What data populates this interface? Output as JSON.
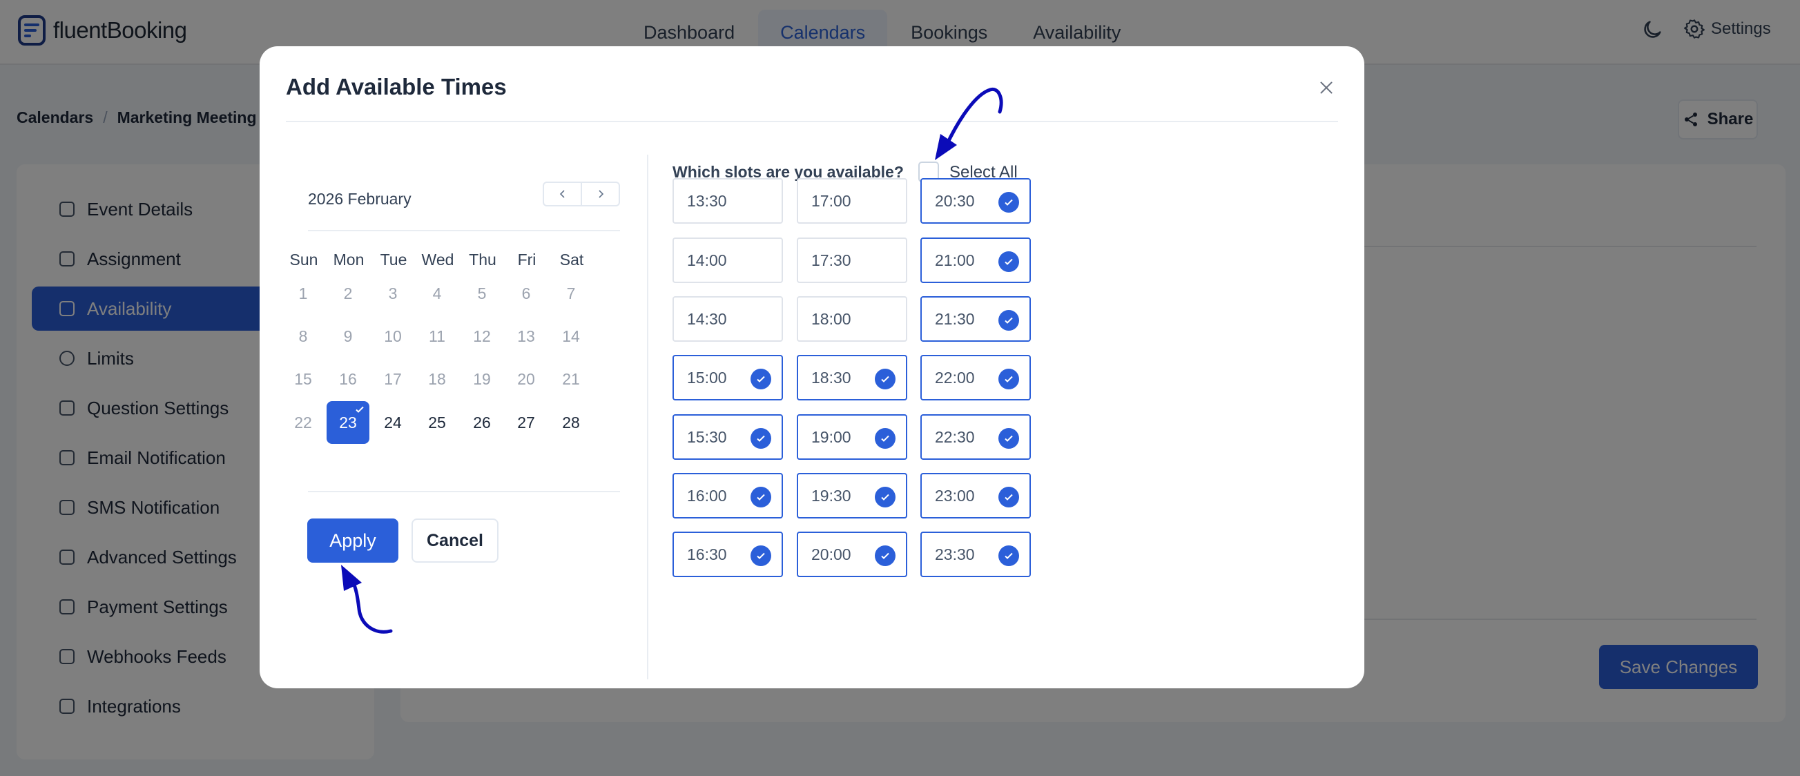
{
  "app": {
    "logo_text": "fluentBooking",
    "nav": [
      {
        "label": "Dashboard",
        "active": false
      },
      {
        "label": "Calendars",
        "active": true
      },
      {
        "label": "Bookings",
        "active": false
      },
      {
        "label": "Availability",
        "active": false
      }
    ],
    "settings_label": "Settings",
    "theme_icon": "moon-icon"
  },
  "breadcrumb": {
    "root": "Calendars",
    "current": "Marketing Meeting"
  },
  "share_label": "Share",
  "sidebar": {
    "items": [
      {
        "label": "Event Details",
        "icon": "document-icon"
      },
      {
        "label": "Assignment",
        "icon": "users-icon"
      },
      {
        "label": "Availability",
        "icon": "calendar-icon",
        "active": true
      },
      {
        "label": "Limits",
        "icon": "clock-icon"
      },
      {
        "label": "Question Settings",
        "icon": "question-icon"
      },
      {
        "label": "Email Notification",
        "icon": "mail-icon"
      },
      {
        "label": "SMS Notification",
        "icon": "sms-icon"
      },
      {
        "label": "Advanced Settings",
        "icon": "sliders-icon"
      },
      {
        "label": "Payment Settings",
        "icon": "payment-icon"
      },
      {
        "label": "Webhooks Feeds",
        "icon": "link-icon"
      },
      {
        "label": "Integrations",
        "icon": "integrations-icon"
      }
    ]
  },
  "save_changes_label": "Save Changes",
  "modal": {
    "title": "Add Available Times",
    "calendar": {
      "month_label": "2026 February",
      "weekdays": [
        "Sun",
        "Mon",
        "Tue",
        "Wed",
        "Thu",
        "Fri",
        "Sat"
      ],
      "weeks": [
        [
          "1",
          "2",
          "3",
          "4",
          "5",
          "6",
          "7"
        ],
        [
          "8",
          "9",
          "10",
          "11",
          "12",
          "13",
          "14"
        ],
        [
          "15",
          "16",
          "17",
          "18",
          "19",
          "20",
          "21"
        ],
        [
          "22",
          "23",
          "24",
          "25",
          "26",
          "27",
          "28"
        ]
      ],
      "selected_day": "23",
      "first_available_day": "23"
    },
    "apply_label": "Apply",
    "cancel_label": "Cancel",
    "slots_question": "Which slots are you available?",
    "select_all_label": "Select All",
    "select_all_checked": false,
    "slot_columns": [
      [
        {
          "time": "13:30",
          "checked": false
        },
        {
          "time": "14:00",
          "checked": false
        },
        {
          "time": "14:30",
          "checked": false
        },
        {
          "time": "15:00",
          "checked": true
        },
        {
          "time": "15:30",
          "checked": true
        },
        {
          "time": "16:00",
          "checked": true
        },
        {
          "time": "16:30",
          "checked": true
        }
      ],
      [
        {
          "time": "17:00",
          "checked": false
        },
        {
          "time": "17:30",
          "checked": false
        },
        {
          "time": "18:00",
          "checked": false
        },
        {
          "time": "18:30",
          "checked": true
        },
        {
          "time": "19:00",
          "checked": true
        },
        {
          "time": "19:30",
          "checked": true
        },
        {
          "time": "20:00",
          "checked": true
        }
      ],
      [
        {
          "time": "20:30",
          "checked": true
        },
        {
          "time": "21:00",
          "checked": true
        },
        {
          "time": "21:30",
          "checked": true
        },
        {
          "time": "22:00",
          "checked": true
        },
        {
          "time": "22:30",
          "checked": true
        },
        {
          "time": "23:00",
          "checked": true
        },
        {
          "time": "23:30",
          "checked": true
        }
      ]
    ]
  },
  "colors": {
    "accent": "#2b5fd9",
    "annotation_arrow": "#0b0bb8"
  }
}
